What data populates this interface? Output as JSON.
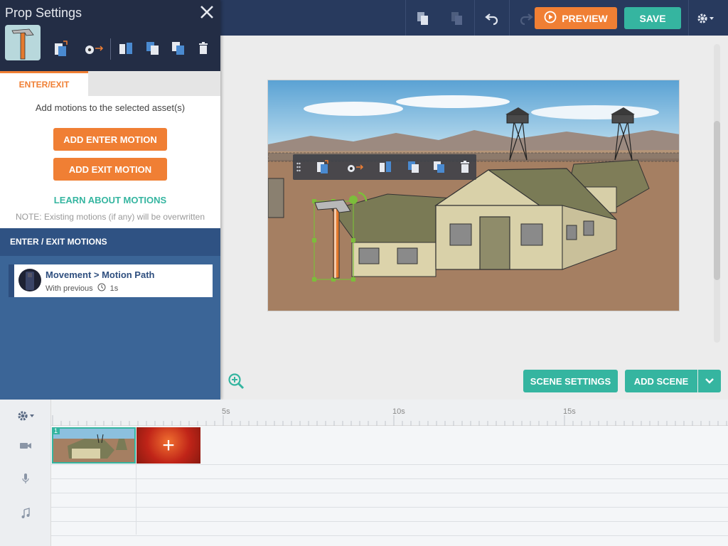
{
  "topbar": {
    "preview_label": "PREVIEW",
    "save_label": "SAVE"
  },
  "panel": {
    "title": "Prop Settings",
    "tab_label": "ENTER/EXIT",
    "description": "Add motions to the selected asset(s)",
    "add_enter_label": "ADD ENTER MOTION",
    "add_exit_label": "ADD EXIT MOTION",
    "learn_label": "LEARN ABOUT MOTIONS",
    "note": "NOTE: Existing motions (if any) will be overwritten",
    "motions_header": "ENTER / EXIT MOTIONS",
    "motions": [
      {
        "title": "Movement > Motion Path",
        "start": "With previous",
        "duration": "1s"
      }
    ]
  },
  "canvas": {
    "scene_settings_label": "SCENE SETTINGS",
    "add_scene_label": "ADD SCENE"
  },
  "timeline": {
    "ticks": [
      "5s",
      "10s",
      "15s"
    ],
    "scene_number": "1",
    "add_tile_symbol": "+"
  },
  "colors": {
    "accent_orange": "#f07f34",
    "accent_teal": "#35b5a0",
    "topbar": "#283a5e",
    "panel_blue": "#3b6597"
  }
}
